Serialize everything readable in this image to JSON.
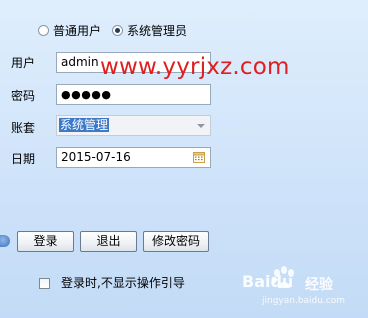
{
  "user_type": {
    "options": [
      {
        "label": "普通用户",
        "selected": false
      },
      {
        "label": "系统管理员",
        "selected": true
      }
    ]
  },
  "form": {
    "user_label": "用户",
    "user_value": "admin",
    "password_label": "密码",
    "password_value": "●●●●●",
    "account_label": "账套",
    "account_value": "系统管理",
    "date_label": "日期",
    "date_value": "2015-07-16"
  },
  "buttons": {
    "login": "登录",
    "exit": "退出",
    "change_password": "修改密码"
  },
  "options": {
    "hide_guide_label": "登录时,不显示操作引导",
    "hide_guide_checked": false
  },
  "overlays": {
    "site_watermark": "www.yyrjxz.com",
    "baidu_brand": "Baidu",
    "baidu_jingyan": "经验",
    "baidu_url": "jingyan.baidu.com"
  },
  "icons": {
    "calendar": "calendar-icon",
    "dropdown": "chevron-down-icon"
  }
}
